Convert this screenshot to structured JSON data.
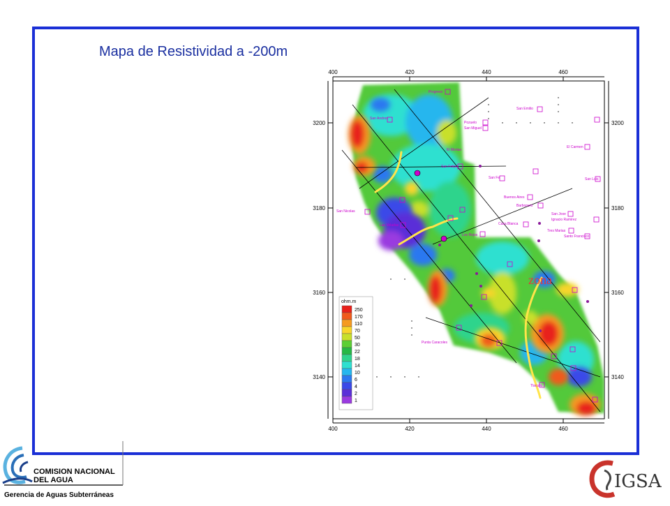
{
  "title": "Mapa de Resistividad a -200m",
  "zone_label": "zona",
  "x_ticks": [
    "400",
    "420",
    "440",
    "460"
  ],
  "y_ticks": [
    "3200",
    "3180",
    "3160",
    "3140"
  ],
  "legend": {
    "unit": "ohm.m",
    "values": [
      "250",
      "170",
      "110",
      "70",
      "50",
      "30",
      "22",
      "18",
      "14",
      "10",
      "6",
      "4",
      "2",
      "1"
    ],
    "colors": [
      "#e8201a",
      "#f05a1c",
      "#f59a20",
      "#f8d52a",
      "#c8e02a",
      "#5ccf34",
      "#26b845",
      "#2fd48c",
      "#2ee0d0",
      "#25b6ee",
      "#2b78f0",
      "#3a48e8",
      "#5a2fd8",
      "#9a3ae0"
    ]
  },
  "sites": [
    {
      "name": "Progreso"
    },
    {
      "name": "San Emilio"
    },
    {
      "name": "San Andres"
    },
    {
      "name": "Pozuelo"
    },
    {
      "name": "San Miguel"
    },
    {
      "name": "El Morlan"
    },
    {
      "name": "El Carmen"
    },
    {
      "name": "San Felipe"
    },
    {
      "name": "San Fe"
    },
    {
      "name": "Buenos Aires"
    },
    {
      "name": "Barbonero"
    },
    {
      "name": "San Nicolas"
    },
    {
      "name": "Las Veladas"
    },
    {
      "name": "Casa Blanca"
    },
    {
      "name": "Tres Marias"
    },
    {
      "name": "Santo Francisco"
    },
    {
      "name": "Los Rojos"
    },
    {
      "name": "Punta Caracoles"
    },
    {
      "name": "Ignacio Ramirez"
    },
    {
      "name": "San Jose"
    },
    {
      "name": "Tlacuilo"
    },
    {
      "name": "San Luis"
    }
  ],
  "logos": {
    "cna_line1": "COMISION NACIONAL",
    "cna_line2": "DEL  AGUA",
    "cna_sub": "Gerencia de Aguas Subterráneas",
    "igsa": "IGSA"
  },
  "colors": {
    "frame": "#1a2fd6",
    "title": "#1a2fa0",
    "contour_line": "#ffe44a",
    "site_marker": "#cc00cc"
  }
}
